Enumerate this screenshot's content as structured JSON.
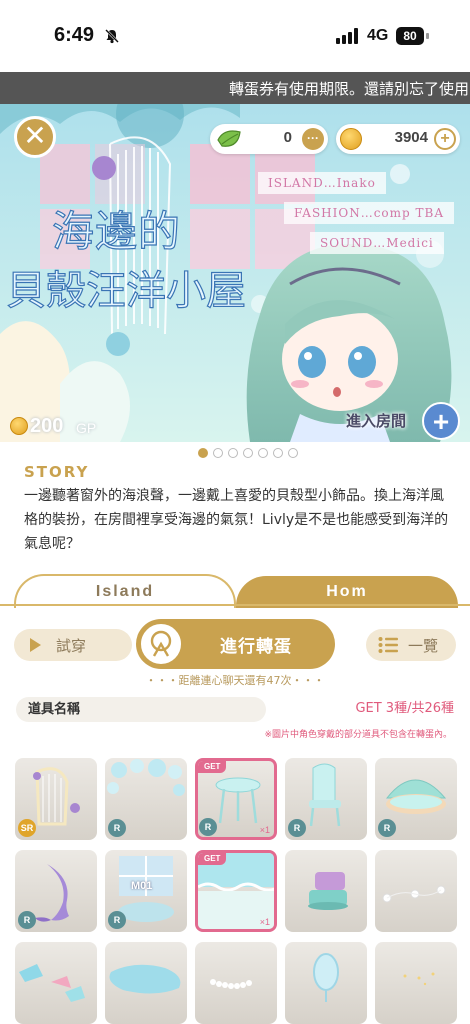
{
  "status_bar": {
    "time": "6:49",
    "network": "4G",
    "battery": "80"
  },
  "marquee": {
    "text": "轉蛋券有使用期限。還請別忘了使用喔"
  },
  "banner": {
    "title_line1": "海邊的",
    "title_line2": "貝殼汪洋小屋",
    "currencies": [
      {
        "icon": "leaf-icon",
        "value": "0"
      },
      {
        "icon": "gold-coin-icon",
        "value": "3904"
      }
    ],
    "credits": [
      "ISLAND…Inako",
      "FASHION…comp TBA",
      "SOUND…Medici"
    ],
    "price": {
      "amount": "200",
      "unit": "GP"
    },
    "enter_room_label": "進入房間",
    "close_icon": "close-icon"
  },
  "carousel": {
    "count": 7,
    "active": 0
  },
  "story": {
    "heading": "STORY",
    "text": "一邊聽著窗外的海浪聲，一邊戴上喜愛的貝殼型小飾品。換上海洋風格的裝扮，在房間裡享受海邊的氣氛！Livly是不是也能感受到海洋的氣息呢？"
  },
  "tabs": [
    {
      "label": "Island",
      "active": true
    },
    {
      "label": "Hom",
      "active": false
    }
  ],
  "actions": {
    "try_label": "試穿",
    "gacha_label": "進行轉蛋",
    "list_label": "一覽",
    "distance_text": "・・・距離連心聊天還有47次・・・"
  },
  "items_header": {
    "name_label": "道具名稱",
    "get_count": "GET 3種/共26種",
    "note": "※圖片中角色穿戴的部分道具不包含在轉蛋內。"
  },
  "items": [
    {
      "name": "harp",
      "rarity": "SR",
      "got": false
    },
    {
      "name": "bubble-wall",
      "rarity": "R",
      "got": false
    },
    {
      "name": "shell-table",
      "rarity": "R",
      "got": true,
      "get_label": "GET",
      "qty": "×1"
    },
    {
      "name": "shell-chair",
      "rarity": "R",
      "got": false
    },
    {
      "name": "shell-bed",
      "rarity": "R",
      "got": false
    },
    {
      "name": "mermaid-tail",
      "rarity": "R",
      "got": false
    },
    {
      "name": "window-set",
      "rarity": "R",
      "got": false,
      "overlay_label": "M01"
    },
    {
      "name": "wave-floor",
      "rarity": "",
      "got": true,
      "get_label": "GET",
      "qty": "×1"
    },
    {
      "name": "jewel-box",
      "rarity": "",
      "got": false
    },
    {
      "name": "pearl-string",
      "rarity": "",
      "got": false
    },
    {
      "name": "seaglass-pieces",
      "rarity": "",
      "got": false
    },
    {
      "name": "water-puddle",
      "rarity": "",
      "got": false
    },
    {
      "name": "pearl-necklace",
      "rarity": "",
      "got": false
    },
    {
      "name": "shell-mirror",
      "rarity": "",
      "got": false
    },
    {
      "name": "sparkles",
      "rarity": "",
      "got": false
    }
  ],
  "colors": {
    "accent_gold": "#c9a24f",
    "accent_pink": "#e05a7c",
    "got_border": "#e26a8f"
  }
}
